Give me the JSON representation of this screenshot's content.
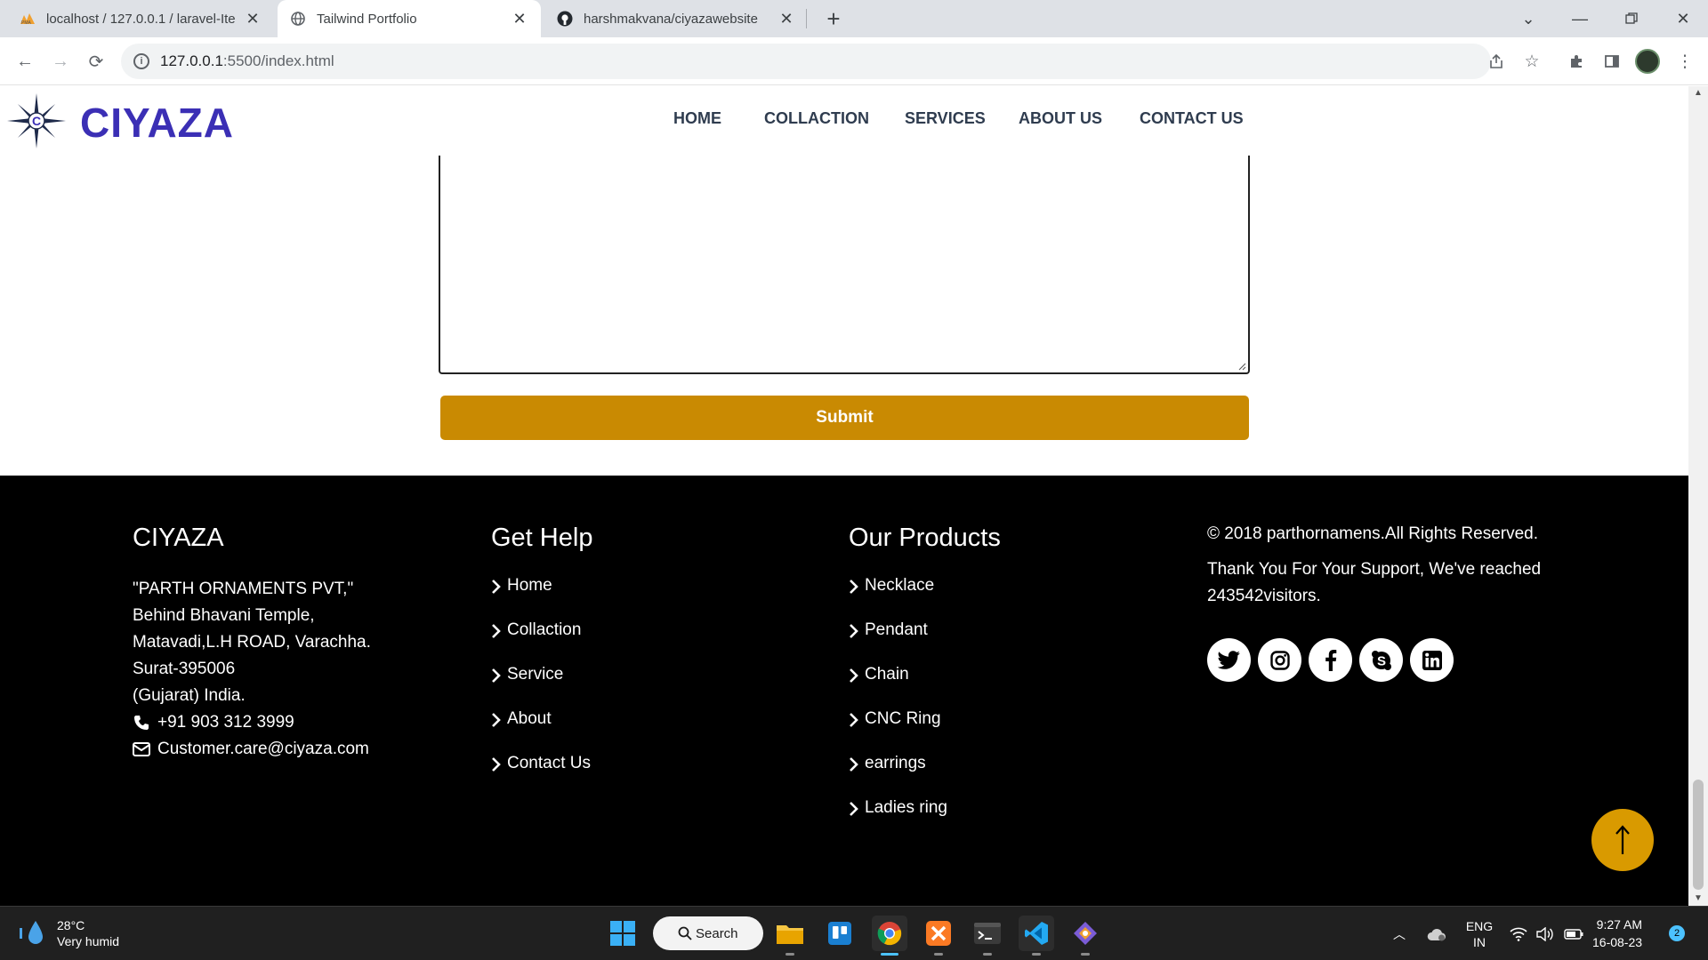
{
  "browser": {
    "tabs": [
      {
        "title": "localhost / 127.0.0.1 / laravel-Ite",
        "icon": "phpmyadmin-icon"
      },
      {
        "title": "Tailwind Portfolio",
        "icon": "globe-icon"
      },
      {
        "title": "harshmakvana/ciyazawebsite",
        "icon": "github-icon"
      }
    ],
    "url_host": "127.0.0.1",
    "url_rest": ":5500/index.html"
  },
  "site": {
    "logo": "CIYAZA",
    "nav": [
      "HOME",
      "COLLACTION",
      "SERVICES",
      "ABOUT US",
      "CONTACT US"
    ],
    "submit_label": "Submit",
    "colors": {
      "brand": "#3b2fb5",
      "accent": "#c98a02",
      "footer_bg": "#000000"
    }
  },
  "footer": {
    "company": {
      "title": "CIYAZA",
      "address": [
        "\"PARTH ORNAMENTS PVT,\"",
        "Behind Bhavani Temple,",
        "Matavadi,L.H ROAD, Varachha.",
        "Surat-395006",
        "(Gujarat) India."
      ],
      "phone": "+91 903 312 3999",
      "email": "Customer.care@ciyaza.com"
    },
    "help": {
      "title": "Get Help",
      "links": [
        "Home",
        "Collaction",
        "Service",
        "About",
        "Contact Us"
      ]
    },
    "products": {
      "title": "Our Products",
      "links": [
        "Necklace",
        "Pendant",
        "Chain",
        "CNC Ring",
        "earrings",
        "Ladies ring"
      ]
    },
    "copyright": "© 2018 parthornamens.All Rights Reserved.",
    "thanks": "Thank You For Your Support, We've reached 243542visitors.",
    "socials": [
      "twitter-icon",
      "instagram-icon",
      "facebook-icon",
      "skype-icon",
      "linkedin-icon"
    ]
  },
  "taskbar": {
    "temp": "28°C",
    "weather": "Very humid",
    "search": "Search",
    "lang1": "ENG",
    "lang2": "IN",
    "time": "9:27 AM",
    "date": "16-08-23",
    "notifications": "2"
  }
}
